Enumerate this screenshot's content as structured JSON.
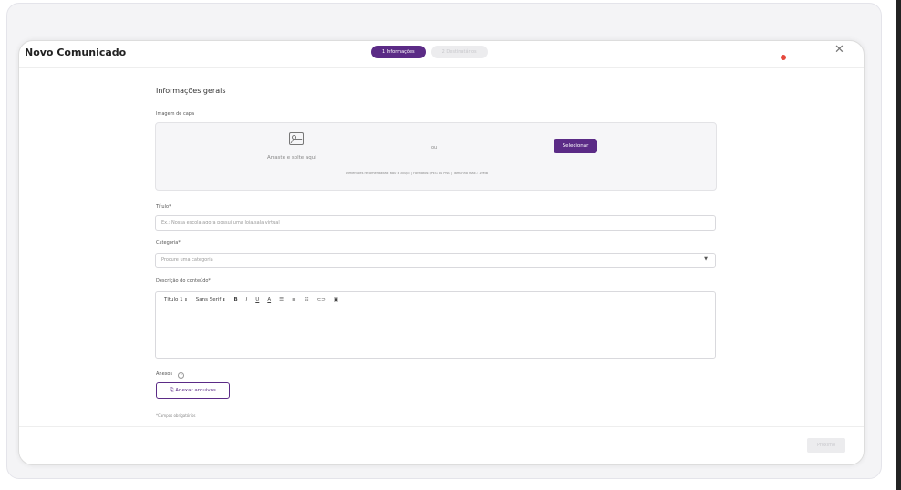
{
  "modal": {
    "title": "Novo Comunicado",
    "steps": [
      {
        "label": "1 Informações",
        "active": true
      },
      {
        "label": "2 Destinatários",
        "active": false
      }
    ],
    "close_icon": "close-icon"
  },
  "form": {
    "section_title": "Informações gerais",
    "cover": {
      "label": "Imagem de capa",
      "icon": "image-icon",
      "drop_text": "Arraste e solte aqui",
      "or_text": "ou",
      "select_label": "Selecionar",
      "hint": "Dimensões recomendadas: 680 x 300px | Formatos: JPEG ou PNG | Tamanho máx.: 10MB"
    },
    "title_field": {
      "label": "Título*",
      "placeholder": "Ex.: Nossa escola agora possui uma loja/sala virtual"
    },
    "category_field": {
      "label": "Categoria*",
      "placeholder": "Procure uma categoria"
    },
    "description": {
      "label": "Descrição do conteúdo*",
      "toolbar": {
        "heading": "Título 1",
        "font": "Sans Serif",
        "bold": "B",
        "italic": "I",
        "underline": "U",
        "color": "A",
        "align": "☰",
        "ordered_list": "≡",
        "bullet_list": "☷",
        "link": "⊂⊃",
        "image": "▣"
      }
    },
    "attachments": {
      "label": "Anexos",
      "help_glyph": "?",
      "button_label": "Anexar arquivos"
    },
    "required_note": "*Campos obrigatórios"
  },
  "footer": {
    "next_label": "Próximo"
  },
  "colors": {
    "accent": "#5b2b86",
    "notification": "#e5483d"
  }
}
